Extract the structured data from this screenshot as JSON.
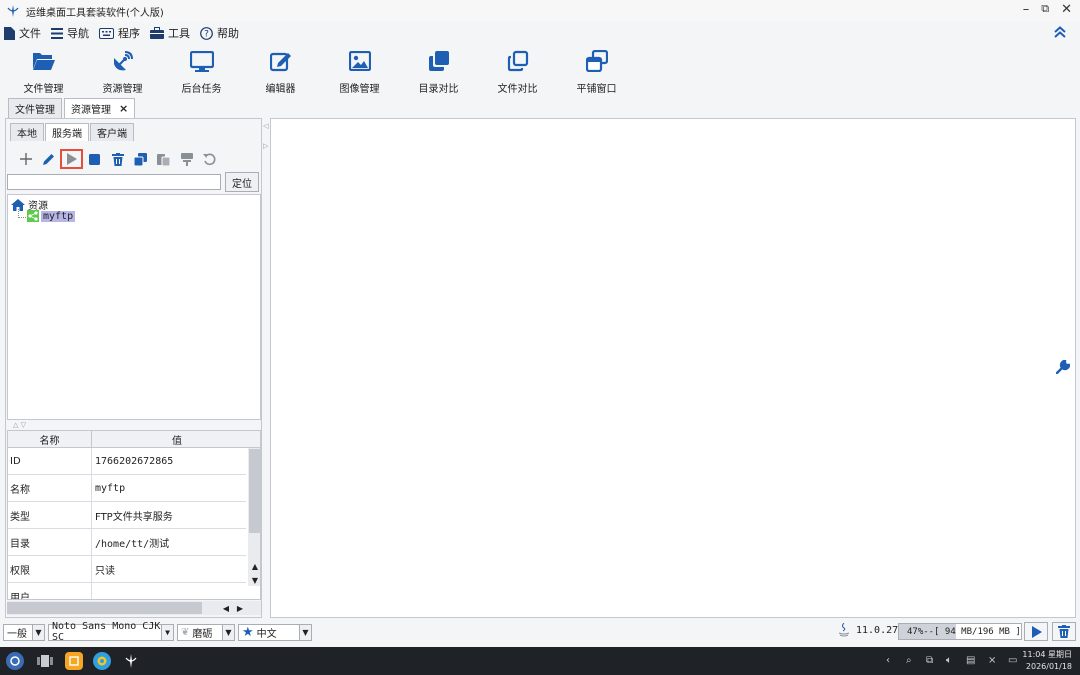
{
  "window": {
    "title": "运维桌面工具套装软件(个人版)"
  },
  "menu": [
    {
      "label": "文件",
      "icon": "file-icon"
    },
    {
      "label": "导航",
      "icon": "list-icon"
    },
    {
      "label": "程序",
      "icon": "keyboard-icon"
    },
    {
      "label": "工具",
      "icon": "toolbox-icon"
    },
    {
      "label": "帮助",
      "icon": "help-icon"
    }
  ],
  "toolbar": [
    {
      "label": "文件管理",
      "icon": "folder-open-icon"
    },
    {
      "label": "资源管理",
      "icon": "satellite-dish-icon"
    },
    {
      "label": "后台任务",
      "icon": "monitor-icon"
    },
    {
      "label": "编辑器",
      "icon": "edit-icon"
    },
    {
      "label": "图像管理",
      "icon": "image-icon"
    },
    {
      "label": "目录对比",
      "icon": "copy-filled-icon"
    },
    {
      "label": "文件对比",
      "icon": "copy-outline-icon"
    },
    {
      "label": "平铺窗口",
      "icon": "window-stack-icon"
    }
  ],
  "doc_tabs": [
    {
      "label": "文件管理",
      "active": false
    },
    {
      "label": "资源管理",
      "active": true,
      "close": "×"
    }
  ],
  "sub_tabs": [
    {
      "label": "本地",
      "active": false
    },
    {
      "label": "服务端",
      "active": true
    },
    {
      "label": "客户端",
      "active": false
    }
  ],
  "resource_toolbar": [
    "add-icon",
    "edit-pencil-icon",
    "start-icon",
    "stop-icon",
    "delete-icon",
    "duplicate-icon",
    "paste-icon",
    "stamp-icon",
    "undo-icon"
  ],
  "search": {
    "value": "",
    "button": "定位"
  },
  "tree": {
    "root": "资源",
    "children": [
      {
        "label": "myftp",
        "selected": true
      }
    ]
  },
  "properties": {
    "headers": [
      "名称",
      "值"
    ],
    "rows": [
      {
        "name": "ID",
        "value": "1766202672865"
      },
      {
        "name": "名称",
        "value": "myftp"
      },
      {
        "name": "类型",
        "value": "FTP文件共享服务"
      },
      {
        "name": "目录",
        "value": "/home/tt/测试"
      },
      {
        "name": "权限",
        "value": "只读"
      },
      {
        "name": "用户",
        "value": ""
      }
    ]
  },
  "statusbar": {
    "mode": "一般",
    "font": "Noto Sans Mono CJK SC",
    "theme": "磨砺",
    "language": "中文",
    "java_version": "11.0.27",
    "memory_text": "47%--[ 94 MB/196 MB ]",
    "memory_percent": 47
  },
  "taskbar": {
    "time": "11:04 星期日",
    "date": "2026/01/18"
  },
  "colors": {
    "accent": "#1e5fb4",
    "highlight_border": "#e74c3c",
    "tree_selection": "#b7b4e6",
    "node_green": "#5ec94a"
  }
}
